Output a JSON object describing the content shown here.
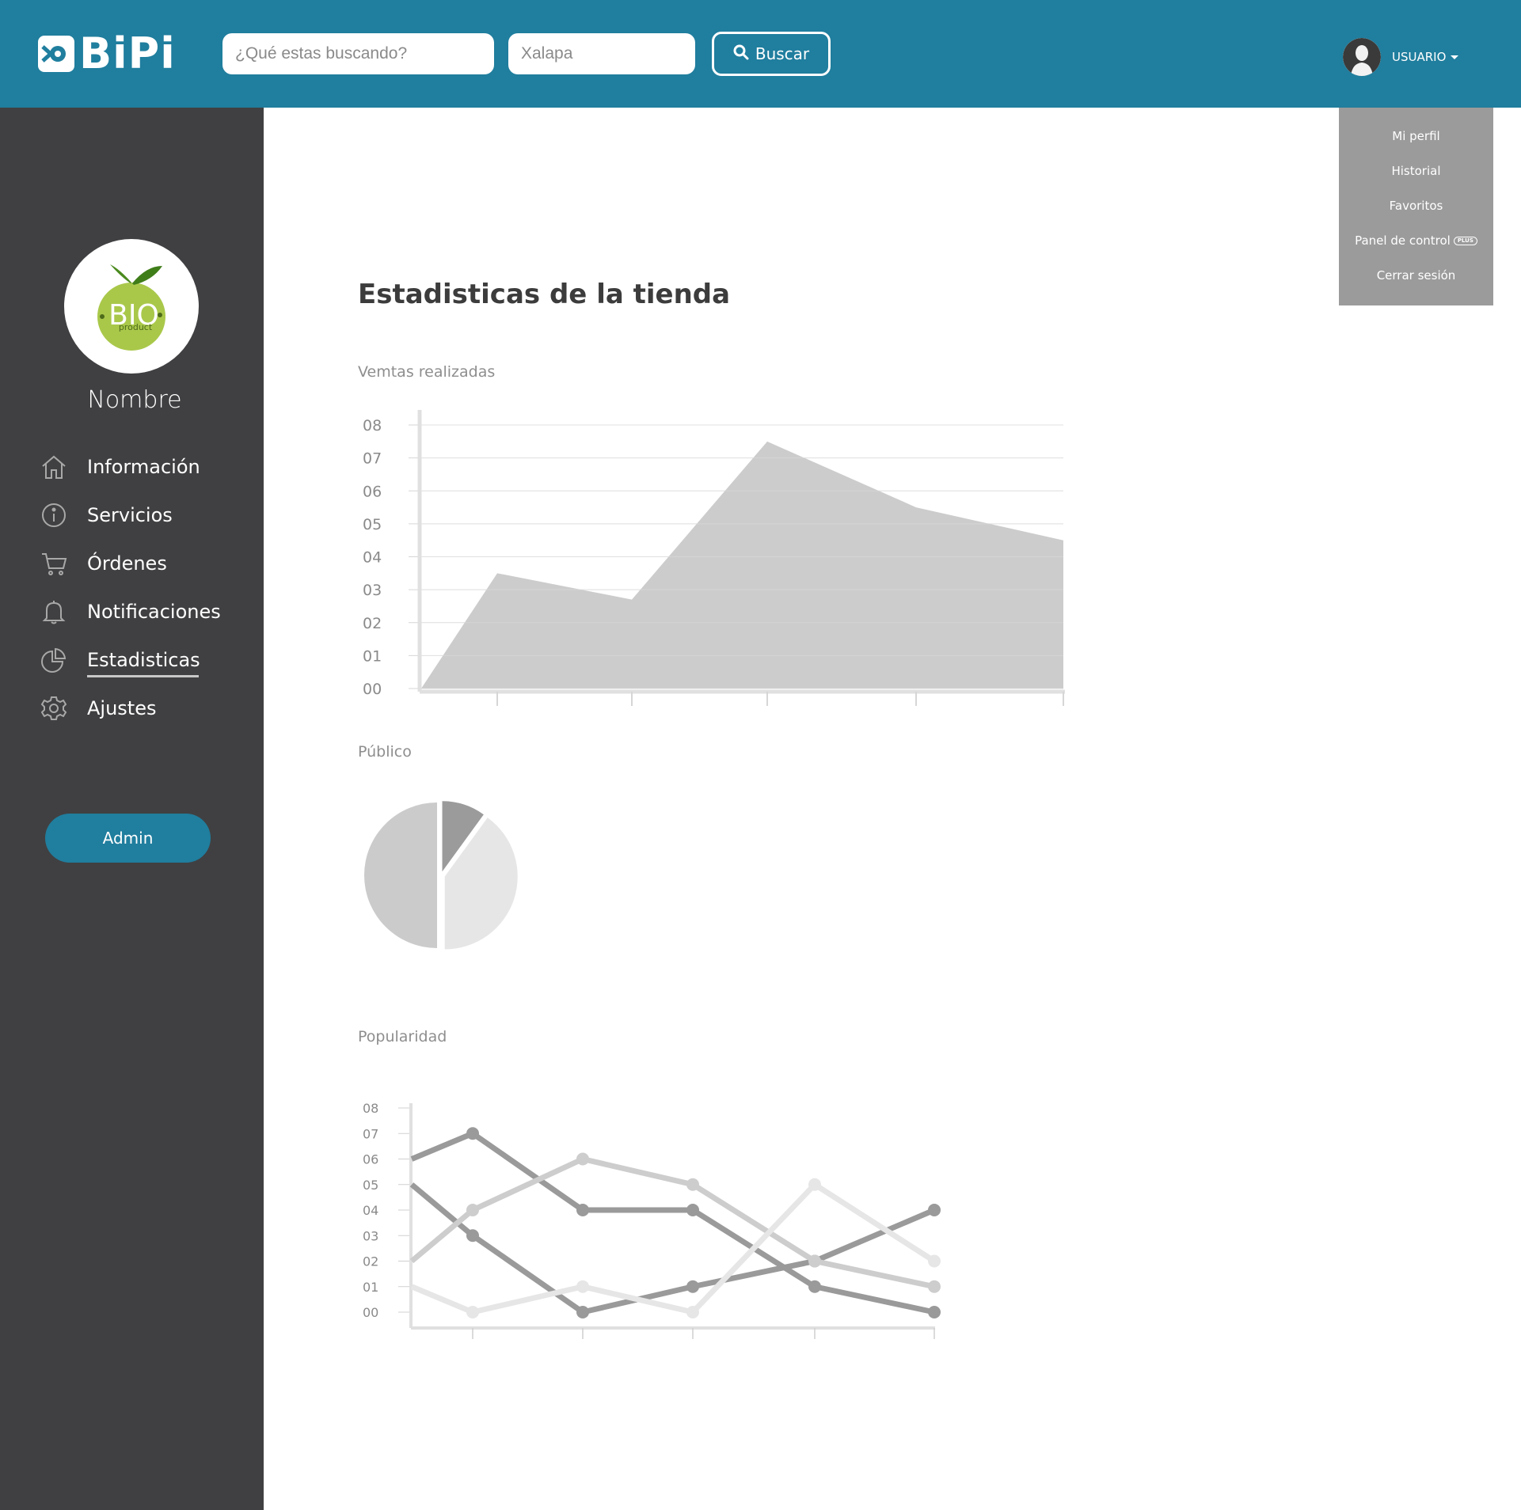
{
  "header": {
    "brand": "BiPi",
    "search_placeholder": "¿Qué estas buscando?",
    "location_placeholder": "Xalapa",
    "search_button": "Buscar",
    "user_label": "USUARIO"
  },
  "user_menu": {
    "items": [
      "Mi perfil",
      "Historial",
      "Favoritos",
      "Panel de control",
      "Cerrar sesión"
    ],
    "plus_badge": "PLUS"
  },
  "sidebar": {
    "name": "Nombre",
    "logo_text": "BIO",
    "logo_subtext": "product",
    "items": [
      {
        "label": "Información",
        "icon": "home-icon"
      },
      {
        "label": "Servicios",
        "icon": "info-icon"
      },
      {
        "label": "Órdenes",
        "icon": "cart-icon"
      },
      {
        "label": "Notificaciones",
        "icon": "bell-icon"
      },
      {
        "label": "Estadisticas",
        "icon": "pie-chart-icon",
        "active": true
      },
      {
        "label": "Ajustes",
        "icon": "gear-icon"
      }
    ],
    "admin_button": "Admin"
  },
  "main": {
    "title": "Estadisticas de la tienda",
    "sales_label": "Vemtas realizadas",
    "audience_label": "Público",
    "popularity_label": "Popularidad"
  },
  "colors": {
    "header": "#207e9e",
    "sidebar": "#404042",
    "dropdown": "#9b9b9b",
    "accent": "#207e9e"
  },
  "chart_data": [
    {
      "type": "area",
      "title": "Vemtas realizadas",
      "ytick_labels": [
        "00",
        "01",
        "02",
        "03",
        "04",
        "05",
        "06",
        "07",
        "08"
      ],
      "ylim": [
        0,
        8
      ],
      "x": [
        0,
        1,
        2,
        3,
        4,
        5
      ],
      "values": [
        0,
        3.5,
        2.7,
        7.5,
        5.5,
        4.5
      ],
      "grid": true
    },
    {
      "type": "pie",
      "title": "Público",
      "values": [
        50,
        10,
        40
      ]
    },
    {
      "type": "line",
      "title": "Popularidad",
      "ytick_labels": [
        "00",
        "01",
        "02",
        "03",
        "04",
        "05",
        "06",
        "07",
        "08"
      ],
      "ylim": [
        0,
        8
      ],
      "x": [
        0,
        1,
        2,
        3,
        4,
        5
      ],
      "series": [
        {
          "values": [
            6,
            7,
            4,
            4,
            1,
            0
          ]
        },
        {
          "values": [
            5,
            3,
            0,
            1,
            2,
            4
          ]
        },
        {
          "values": [
            2,
            4,
            6,
            5,
            2,
            1
          ]
        },
        {
          "values": [
            1,
            0,
            1,
            0,
            5,
            2
          ]
        }
      ]
    }
  ]
}
